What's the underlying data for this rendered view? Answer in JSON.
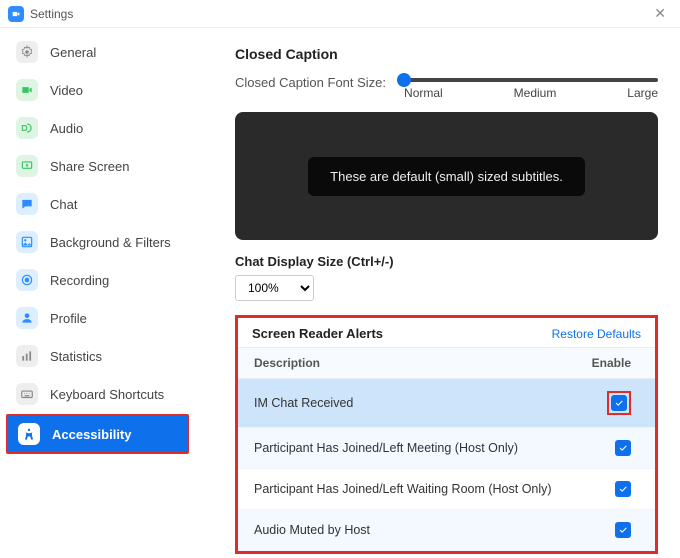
{
  "window": {
    "title": "Settings"
  },
  "sidebar": {
    "items": [
      {
        "label": "General",
        "icon": "gear"
      },
      {
        "label": "Video",
        "icon": "video"
      },
      {
        "label": "Audio",
        "icon": "audio"
      },
      {
        "label": "Share Screen",
        "icon": "share"
      },
      {
        "label": "Chat",
        "icon": "chat"
      },
      {
        "label": "Background & Filters",
        "icon": "bg"
      },
      {
        "label": "Recording",
        "icon": "rec"
      },
      {
        "label": "Profile",
        "icon": "profile"
      },
      {
        "label": "Statistics",
        "icon": "stats"
      },
      {
        "label": "Keyboard Shortcuts",
        "icon": "keyboard"
      },
      {
        "label": "Accessibility",
        "icon": "access",
        "active": true
      }
    ]
  },
  "closed_caption": {
    "title": "Closed Caption",
    "font_size_label": "Closed Caption Font Size:",
    "slider_labels": [
      "Normal",
      "Medium",
      "Large"
    ],
    "preview_text": "These are default (small) sized subtitles."
  },
  "chat_size": {
    "label": "Chat Display Size (Ctrl+/-)",
    "value": "100%"
  },
  "alerts": {
    "title": "Screen Reader Alerts",
    "restore": "Restore Defaults",
    "columns": {
      "desc": "Description",
      "enable": "Enable"
    },
    "rows": [
      {
        "desc": "IM Chat Received",
        "checked": true,
        "selected": true
      },
      {
        "desc": "Participant Has Joined/Left Meeting (Host Only)",
        "checked": true
      },
      {
        "desc": "Participant Has Joined/Left Waiting Room (Host Only)",
        "checked": true
      },
      {
        "desc": "Audio Muted by Host",
        "checked": true
      }
    ]
  }
}
